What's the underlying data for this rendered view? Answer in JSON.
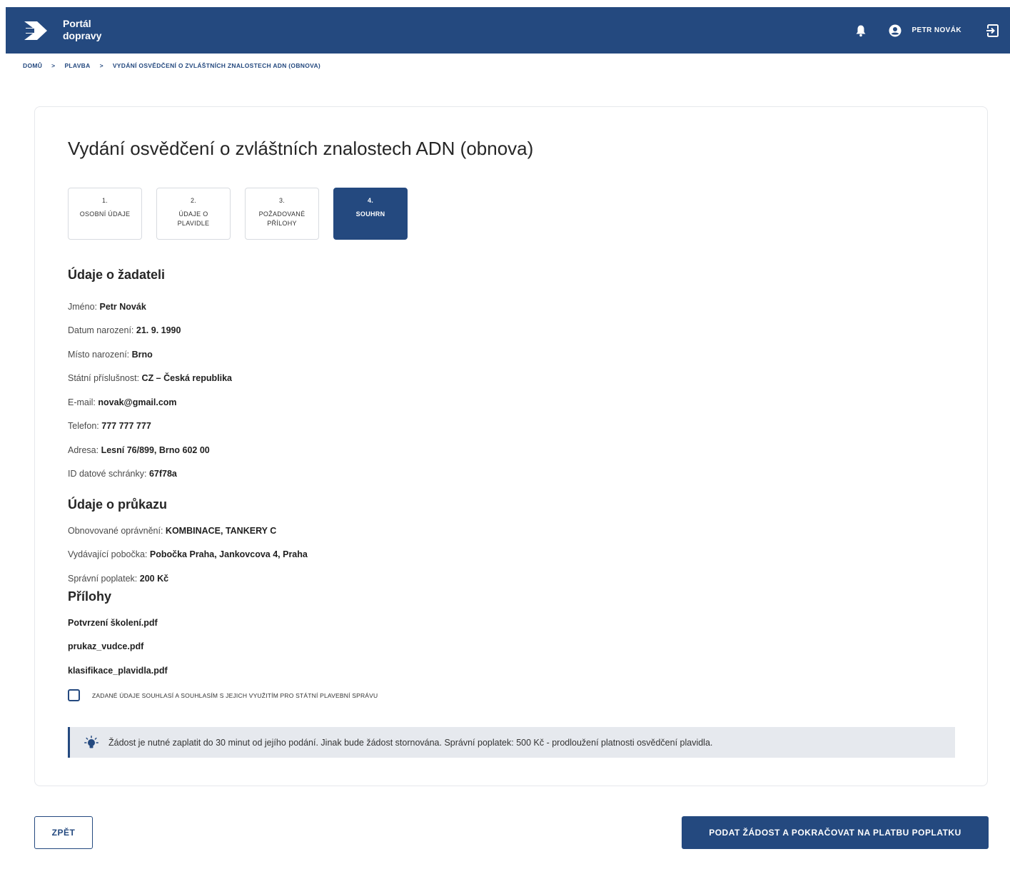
{
  "header": {
    "brand_line1": "Portál",
    "brand_line2": "dopravy",
    "user_name": "PETR NOVÁK",
    "icons": {
      "bell": "bell-icon",
      "user": "account-circle-icon",
      "logout": "logout-icon",
      "logo": "logo-arrow-icon"
    }
  },
  "breadcrumb": {
    "items": [
      "DOMŮ",
      "PLAVBA",
      "VYDÁNÍ OSVĚDČENÍ O ZVLÁŠTNÍCH ZNALOSTECH ADN (OBNOVA)"
    ],
    "separator": ">"
  },
  "page": {
    "title": "Vydání osvědčení o zvláštních znalostech ADN (obnova)"
  },
  "steps": [
    {
      "num": "1.",
      "label": "OSOBNÍ ÚDAJE"
    },
    {
      "num": "2.",
      "label": "ÚDAJE O PLAVIDLE"
    },
    {
      "num": "3.",
      "label": "POŽADOVANÉ PŘÍLOHY"
    },
    {
      "num": "4.",
      "label": "SOUHRN"
    }
  ],
  "applicant": {
    "heading": "Údaje o žadateli",
    "fields": [
      {
        "label": "Jméno:",
        "value": "Petr Novák"
      },
      {
        "label": "Datum narození:",
        "value": "21. 9. 1990"
      },
      {
        "label": "Místo narození:",
        "value": "Brno"
      },
      {
        "label": "Státní příslušnost:",
        "value": "CZ – Česká republika"
      },
      {
        "label": "E-mail:",
        "value": "novak@gmail.com"
      },
      {
        "label": "Telefon:",
        "value": "777 777 777"
      },
      {
        "label": "Adresa:",
        "value": "Lesní 76/899, Brno 602 00"
      },
      {
        "label": "ID datové schránky:",
        "value": "67f78a"
      }
    ]
  },
  "license": {
    "heading": "Údaje o průkazu",
    "fields": [
      {
        "label": "Obnovované oprávnění:",
        "value": "KOMBINACE, TANKERY C"
      },
      {
        "label": "Vydávající pobočka:",
        "value": "Pobočka Praha, Jankovcova 4, Praha"
      },
      {
        "label": "Správní poplatek:",
        "value": "200 Kč"
      }
    ]
  },
  "attachments": {
    "heading": "Přílohy",
    "files": [
      "Potvrzení školení.pdf",
      "prukaz_vudce.pdf",
      "klasifikace_plavidla.pdf"
    ]
  },
  "consent": {
    "label": "ZADANÉ ÚDAJE SOUHLASÍ A SOUHLASÍM S JEJICH VYUŽITÍM PRO STÁTNÍ PLAVEBNÍ SPRÁVU",
    "checked": false
  },
  "notice": {
    "icon": "lightbulb-icon",
    "text": "Žádost je nutné zaplatit do 30 minut od jejího podání. Jinak bude žádost stornována. Správní poplatek: 500 Kč - prodloužení platnosti osvědčení plavidla."
  },
  "buttons": {
    "back": "ZPĚT",
    "submit": "PODAT ŽÁDOST A POKRAČOVAT NA PLATBU POPLATKU"
  },
  "colors": {
    "primary": "#24497f",
    "notice_bg": "#e6e9ee"
  }
}
